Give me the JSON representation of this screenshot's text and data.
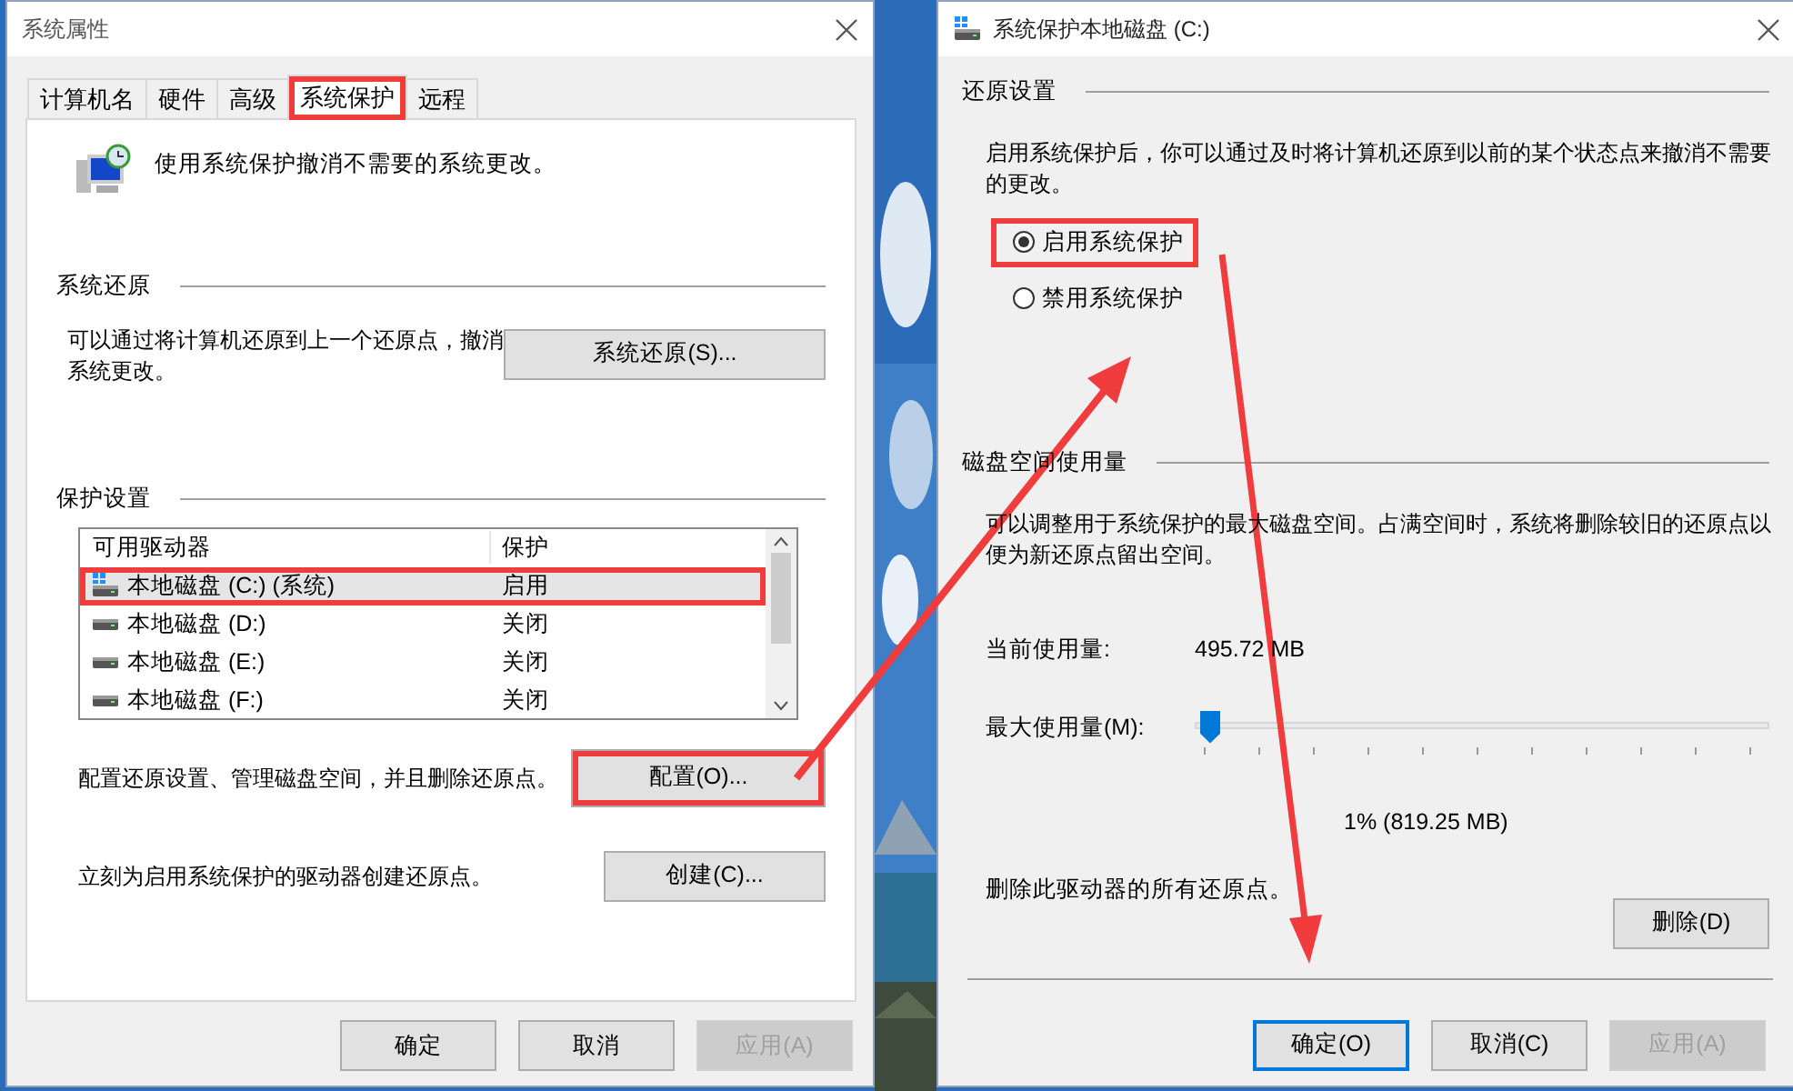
{
  "left_window": {
    "title": "系统属性",
    "tabs": [
      {
        "label": "计算机名",
        "selected": false,
        "highlighted": false
      },
      {
        "label": "硬件",
        "selected": false,
        "highlighted": false
      },
      {
        "label": "高级",
        "selected": false,
        "highlighted": false
      },
      {
        "label": "系统保护",
        "selected": true,
        "highlighted": true
      },
      {
        "label": "远程",
        "selected": false,
        "highlighted": false
      }
    ],
    "intro": "使用系统保护撤消不需要的系统更改。",
    "restore_section": {
      "heading": "系统还原",
      "text": "可以通过将计算机还原到上一个还原点，撤消系统更改。",
      "button": "系统还原(S)..."
    },
    "protection_section": {
      "heading": "保护设置",
      "columns": [
        "可用驱动器",
        "保护"
      ],
      "drives": [
        {
          "kind": "system",
          "name": "本地磁盘 (C:) (系统)",
          "protection": "启用",
          "selected": true,
          "highlighted": true
        },
        {
          "kind": "disk",
          "name": "本地磁盘 (D:)",
          "protection": "关闭",
          "selected": false,
          "highlighted": false
        },
        {
          "kind": "disk",
          "name": "本地磁盘 (E:)",
          "protection": "关闭",
          "selected": false,
          "highlighted": false
        },
        {
          "kind": "disk",
          "name": "本地磁盘 (F:)",
          "protection": "关闭",
          "selected": false,
          "highlighted": false
        }
      ],
      "configure": {
        "text": "配置还原设置、管理磁盘空间，并且删除还原点。",
        "button": "配置(O)...",
        "highlighted": true
      },
      "create": {
        "text": "立刻为启用系统保护的驱动器创建还原点。",
        "button": "创建(C)...",
        "highlighted": false
      }
    },
    "buttons": [
      {
        "label": "确定",
        "disabled": false
      },
      {
        "label": "取消",
        "disabled": false
      },
      {
        "label": "应用(A)",
        "disabled": true
      }
    ]
  },
  "right_window": {
    "title": "系统保护本地磁盘 (C:)",
    "restore_settings": {
      "heading": "还原设置",
      "text": "启用系统保护后，你可以通过及时将计算机还原到以前的某个状态点来撤消不需要的更改。",
      "options": [
        {
          "label": "启用系统保护",
          "selected": true,
          "highlighted": true
        },
        {
          "label": "禁用系统保护",
          "selected": false,
          "highlighted": false
        }
      ]
    },
    "disk_usage": {
      "heading": "磁盘空间使用量",
      "text": "可以调整用于系统保护的最大磁盘空间。占满空间时，系统将删除较旧的还原点以便为新还原点留出空间。",
      "current_label": "当前使用量:",
      "current_value": "495.72 MB",
      "max_label": "最大使用量(M):",
      "slider": {
        "level": 0.01
      },
      "slider_reading": "1% (819.25 MB)",
      "delete_text": "删除此驱动器的所有还原点。",
      "delete_button": "删除(D)"
    },
    "buttons": [
      {
        "label": "确定(O)",
        "default": true,
        "disabled": false
      },
      {
        "label": "取消(C)",
        "default": false,
        "disabled": false
      },
      {
        "label": "应用(A)",
        "default": false,
        "disabled": true
      }
    ]
  }
}
